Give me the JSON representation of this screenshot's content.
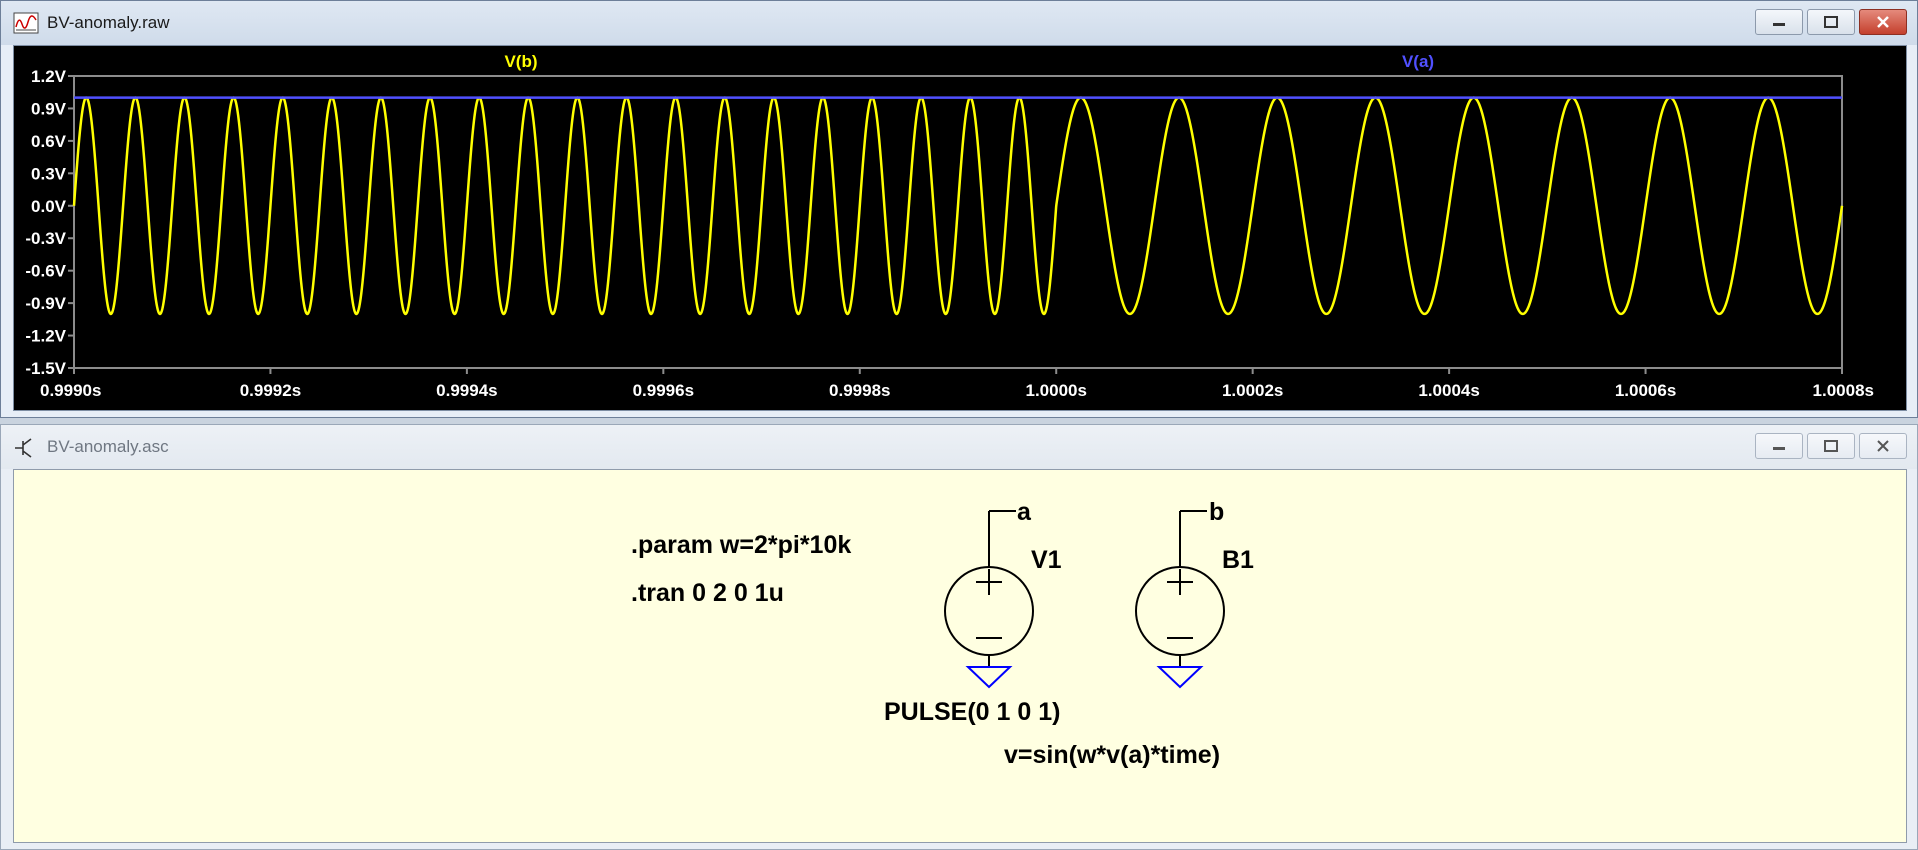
{
  "raw_window": {
    "title": "BV-anomaly.raw",
    "buttons": [
      "minimize",
      "maximize",
      "close"
    ]
  },
  "asc_window": {
    "title": "BV-anomaly.asc",
    "buttons": [
      "minimize",
      "maximize",
      "close"
    ]
  },
  "colors": {
    "trace_vb": "#ffff00",
    "trace_va": "#5050ff",
    "plot_bg": "#000000",
    "axis_text": "#ffffff",
    "schematic_bg": "#ffffe1",
    "ground": "#0000ff"
  },
  "chart_data": {
    "type": "line",
    "title": "",
    "xlabel": "",
    "ylabel": "",
    "xlim": [
      0.999,
      1.0008
    ],
    "ylim": [
      -1.5,
      1.2
    ],
    "x_ticks": [
      "0.9990s",
      "0.9992s",
      "0.9994s",
      "0.9996s",
      "0.9998s",
      "1.0000s",
      "1.0002s",
      "1.0004s",
      "1.0006s",
      "1.0008s"
    ],
    "y_ticks": [
      "1.2V",
      "0.9V",
      "0.6V",
      "0.3V",
      "0.0V",
      "-0.3V",
      "-0.6V",
      "-0.9V",
      "-1.2V",
      "-1.5V"
    ],
    "grid": false,
    "series": [
      {
        "name": "V(b)",
        "description_values": "sine, amplitude 1",
        "segments": [
          {
            "x_start": 0.999,
            "x_end": 1.0,
            "frequency_hz": 20000
          },
          {
            "x_start": 1.0,
            "x_end": 1.0008,
            "frequency_hz": 10000
          }
        ],
        "amplitude": 1
      },
      {
        "name": "V(a)",
        "constant_value": 1
      }
    ]
  },
  "schematic": {
    "directives": [
      ".param w=2*pi*10k",
      ".tran 0 2 0 1u"
    ],
    "v1": {
      "name": "V1",
      "net": "a",
      "value": "PULSE(0 1 0 1)"
    },
    "b1": {
      "name": "B1",
      "net": "b",
      "value": "v=sin(w*v(a)*time)"
    }
  }
}
